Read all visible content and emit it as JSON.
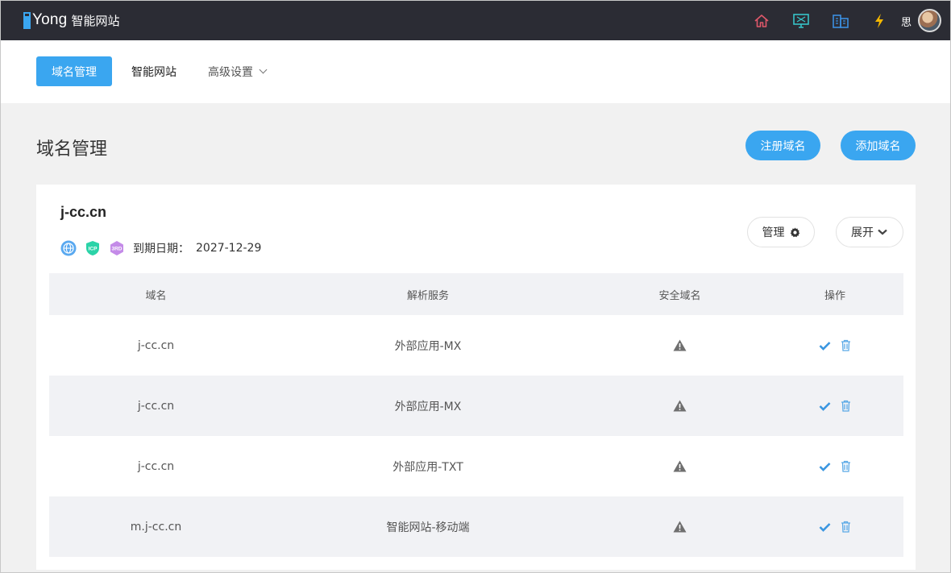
{
  "app": {
    "logo_text": "Yong",
    "logo_sub": "智能网站",
    "user_name": "思"
  },
  "top_icons": [
    "home-icon",
    "monitor-icon",
    "building-icon",
    "lightning-icon"
  ],
  "colors": {
    "accent": "#3aa6f0",
    "topbar": "#2b2c34",
    "home": "#e0586a",
    "monitor": "#36c4c9",
    "building": "#3b8fe0",
    "lightning": "#f5b800"
  },
  "nav": {
    "items": [
      {
        "label": "域名管理",
        "active": true
      },
      {
        "label": "智能网站",
        "active": false
      },
      {
        "label": "高级设置",
        "active": false
      }
    ]
  },
  "page": {
    "title": "域名管理",
    "register_label": "注册域名",
    "add_label": "添加域名"
  },
  "card": {
    "domain": "j-cc.cn",
    "badges": [
      "globe-icon",
      "icp-badge-icon",
      "3rd-badge-icon"
    ],
    "icp_text": "ICP",
    "third_text": "3RD",
    "expire_label": "到期日期：",
    "expire_date": "2027-12-29",
    "manage_label": "管理",
    "expand_label": "展开"
  },
  "table": {
    "headers": [
      "域名",
      "解析服务",
      "安全域名",
      "操作"
    ],
    "rows": [
      {
        "domain": "j-cc.cn",
        "service": "外部应用-MX"
      },
      {
        "domain": "j-cc.cn",
        "service": "外部应用-MX"
      },
      {
        "domain": "j-cc.cn",
        "service": "外部应用-TXT"
      },
      {
        "domain": "m.j-cc.cn",
        "service": "智能网站-移动端"
      }
    ]
  }
}
